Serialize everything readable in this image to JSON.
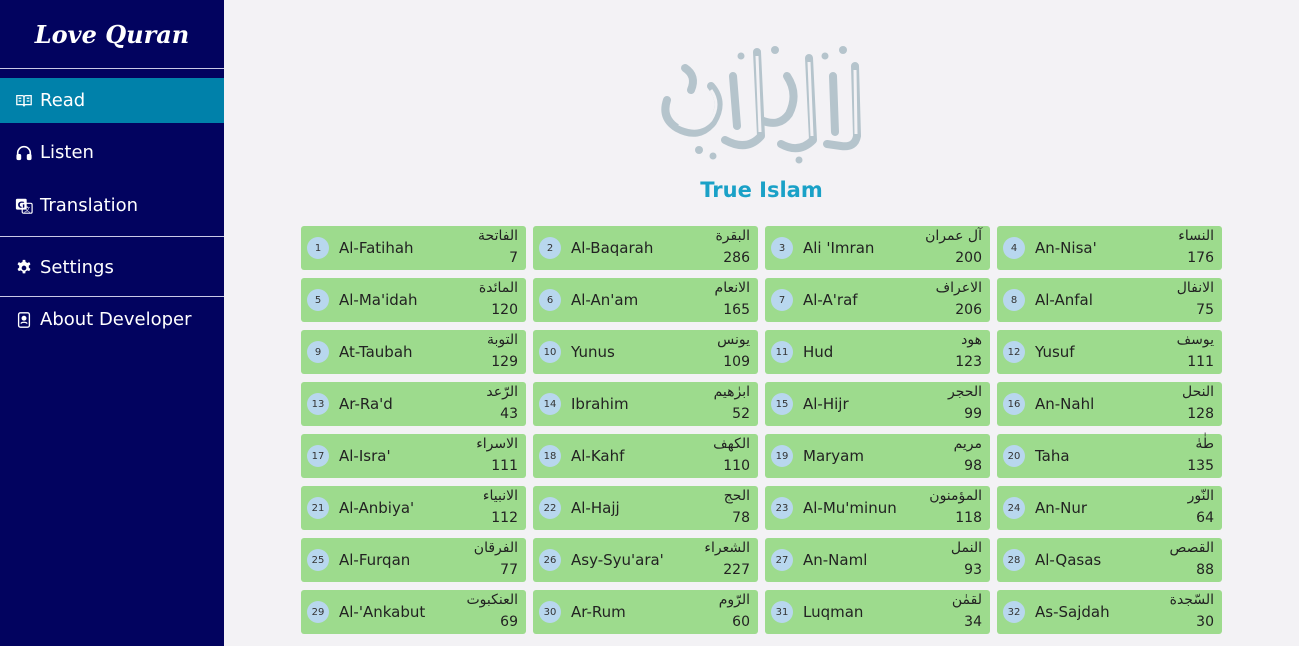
{
  "brand": "Love Quran",
  "nav": {
    "read": "Read",
    "listen": "Listen",
    "translation": "Translation",
    "settings": "Settings",
    "about": "About Developer"
  },
  "header": {
    "calligraphy": "القرآن الكريم",
    "subtitle": "True Islam"
  },
  "colors": {
    "sidebar": "#02035f",
    "active": "#0081aa",
    "card": "#9ddb8d",
    "badge": "#b8d7ee",
    "subtitle": "#1aa1c7"
  },
  "surahs": [
    {
      "num": "1",
      "name": "Al-Fatihah",
      "arabic": "الفاتحة",
      "verses": "7"
    },
    {
      "num": "2",
      "name": "Al-Baqarah",
      "arabic": "البقرة",
      "verses": "286"
    },
    {
      "num": "3",
      "name": "Ali 'Imran",
      "arabic": "آل عمران",
      "verses": "200"
    },
    {
      "num": "4",
      "name": "An-Nisa'",
      "arabic": "النساء",
      "verses": "176"
    },
    {
      "num": "5",
      "name": "Al-Ma'idah",
      "arabic": "المائدة",
      "verses": "120"
    },
    {
      "num": "6",
      "name": "Al-An'am",
      "arabic": "الانعام",
      "verses": "165"
    },
    {
      "num": "7",
      "name": "Al-A'raf",
      "arabic": "الاعراف",
      "verses": "206"
    },
    {
      "num": "8",
      "name": "Al-Anfal",
      "arabic": "الانفال",
      "verses": "75"
    },
    {
      "num": "9",
      "name": "At-Taubah",
      "arabic": "التوبة",
      "verses": "129"
    },
    {
      "num": "10",
      "name": "Yunus",
      "arabic": "يونس",
      "verses": "109"
    },
    {
      "num": "11",
      "name": "Hud",
      "arabic": "هود",
      "verses": "123"
    },
    {
      "num": "12",
      "name": "Yusuf",
      "arabic": "يوسف",
      "verses": "111"
    },
    {
      "num": "13",
      "name": "Ar-Ra'd",
      "arabic": "الرّعد",
      "verses": "43"
    },
    {
      "num": "14",
      "name": "Ibrahim",
      "arabic": "ابرٰهيم",
      "verses": "52"
    },
    {
      "num": "15",
      "name": "Al-Hijr",
      "arabic": "الحجر",
      "verses": "99"
    },
    {
      "num": "16",
      "name": "An-Nahl",
      "arabic": "النحل",
      "verses": "128"
    },
    {
      "num": "17",
      "name": "Al-Isra'",
      "arabic": "الاسراء",
      "verses": "111"
    },
    {
      "num": "18",
      "name": "Al-Kahf",
      "arabic": "الكهف",
      "verses": "110"
    },
    {
      "num": "19",
      "name": "Maryam",
      "arabic": "مريم",
      "verses": "98"
    },
    {
      "num": "20",
      "name": "Taha",
      "arabic": "طٰهٰ",
      "verses": "135"
    },
    {
      "num": "21",
      "name": "Al-Anbiya'",
      "arabic": "الانبياء",
      "verses": "112"
    },
    {
      "num": "22",
      "name": "Al-Hajj",
      "arabic": "الحج",
      "verses": "78"
    },
    {
      "num": "23",
      "name": "Al-Mu'minun",
      "arabic": "المؤمنون",
      "verses": "118"
    },
    {
      "num": "24",
      "name": "An-Nur",
      "arabic": "النّور",
      "verses": "64"
    },
    {
      "num": "25",
      "name": "Al-Furqan",
      "arabic": "الفرقان",
      "verses": "77"
    },
    {
      "num": "26",
      "name": "Asy-Syu'ara'",
      "arabic": "الشعراء",
      "verses": "227"
    },
    {
      "num": "27",
      "name": "An-Naml",
      "arabic": "النمل",
      "verses": "93"
    },
    {
      "num": "28",
      "name": "Al-Qasas",
      "arabic": "القصص",
      "verses": "88"
    },
    {
      "num": "29",
      "name": "Al-'Ankabut",
      "arabic": "العنكبوت",
      "verses": "69"
    },
    {
      "num": "30",
      "name": "Ar-Rum",
      "arabic": "الرّوم",
      "verses": "60"
    },
    {
      "num": "31",
      "name": "Luqman",
      "arabic": "لقمٰن",
      "verses": "34"
    },
    {
      "num": "32",
      "name": "As-Sajdah",
      "arabic": "السّجدة",
      "verses": "30"
    }
  ]
}
